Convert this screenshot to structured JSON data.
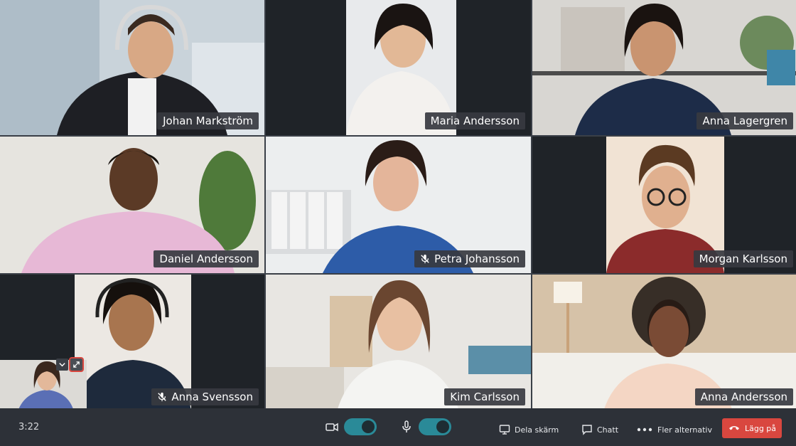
{
  "participants": [
    {
      "name": "Johan Markström",
      "muted": false,
      "active": false
    },
    {
      "name": "Maria Andersson",
      "muted": false,
      "active": false
    },
    {
      "name": "Anna Lagergren",
      "muted": false,
      "active": false
    },
    {
      "name": "Daniel Andersson",
      "muted": false,
      "active": true
    },
    {
      "name": "Petra Johansson",
      "muted": true,
      "active": false
    },
    {
      "name": "Morgan Karlsson",
      "muted": false,
      "active": false
    },
    {
      "name": "Anna Svensson",
      "muted": true,
      "active": false
    },
    {
      "name": "Kim Carlsson",
      "muted": false,
      "active": false
    },
    {
      "name": "Anna Andersson",
      "muted": false,
      "active": false
    }
  ],
  "toolbar": {
    "timer": "3:22",
    "camera_on": true,
    "mic_on": true,
    "share_label": "Dela skärm",
    "chat_label": "Chatt",
    "more_label": "Fler alternativ",
    "leave_label": "Lägg på"
  },
  "colors": {
    "accent": "#2a8a98",
    "leave": "#d9473f",
    "toolbar": "#2d3138",
    "name_tag": "#373a40"
  },
  "icons": [
    "mic-muted-icon",
    "chevron-down-icon",
    "expand-icon",
    "camera-icon",
    "microphone-icon",
    "screen-share-icon",
    "chat-icon",
    "more-dots-icon",
    "phone-hangup-icon"
  ]
}
